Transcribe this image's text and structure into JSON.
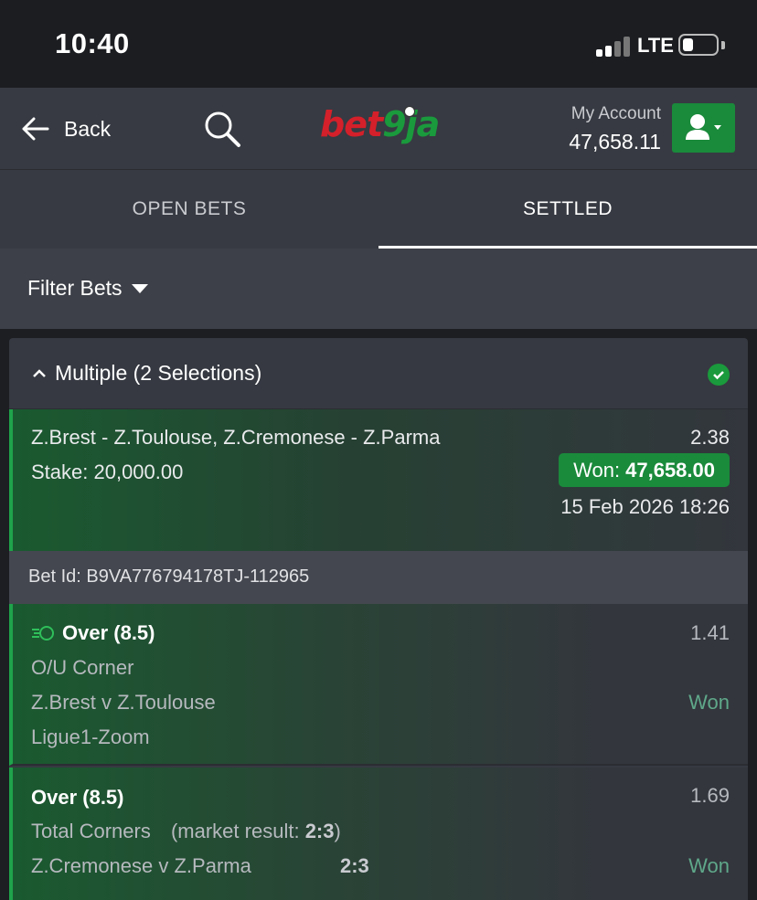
{
  "status_bar": {
    "time": "10:40",
    "network": "LTE"
  },
  "header": {
    "back_label": "Back",
    "logo_part1": "bet",
    "logo_part2": "9ja",
    "account_label": "My Account",
    "account_balance": "47,658.11"
  },
  "tabs": [
    {
      "label": "OPEN BETS",
      "active": false
    },
    {
      "label": "SETTLED",
      "active": true
    }
  ],
  "filter": {
    "label": "Filter Bets"
  },
  "bet": {
    "title": "Multiple (2 Selections)",
    "teams": "Z.Brest - Z.Toulouse, Z.Cremonese - Z.Parma",
    "stake": "Stake: 20,000.00",
    "total_odds": "2.38",
    "won_label": "Won:",
    "won_amount": "47,658.00",
    "settled_date": "15 Feb 2026 18:26",
    "bet_id": "Bet Id: B9VA776794178TJ-112965",
    "selections": [
      {
        "pick": "Over (8.5)",
        "odds": "1.41",
        "market": "O/U Corner",
        "match": "Z.Brest v Z.Toulouse",
        "league": "Ligue1-Zoom",
        "status": "Won"
      },
      {
        "pick": "Over (8.5)",
        "odds": "1.69",
        "market": "Total Corners",
        "market_result_label": "(market result:",
        "market_result": "2:3",
        "market_result_close": ")",
        "match": "Z.Cremonese v Z.Parma",
        "score": "2:3",
        "status": "Won"
      }
    ]
  },
  "colors": {
    "brand_green": "#1a8a3b",
    "brand_red": "#d4202a",
    "won_text": "#5fa88a"
  }
}
